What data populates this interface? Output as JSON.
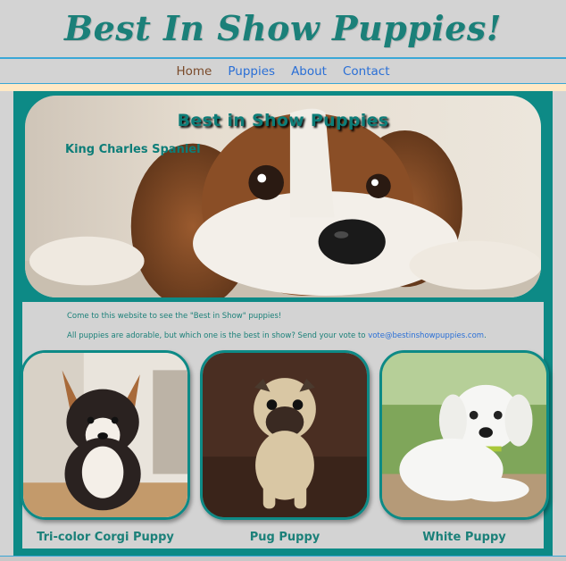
{
  "header": {
    "title": "Best In Show Puppies!"
  },
  "nav": {
    "items": [
      {
        "label": "Home",
        "active": true
      },
      {
        "label": "Puppies",
        "active": false
      },
      {
        "label": "About",
        "active": false
      },
      {
        "label": "Contact",
        "active": false
      }
    ]
  },
  "hero": {
    "title": "Best in Show Puppies",
    "caption": "King Charles Spaniel"
  },
  "intro": {
    "line1": "Come to this website to see the \"Best in Show\" puppies!",
    "line2_prefix": "All puppies are adorable, but which one is the best in show? Send your vote to ",
    "email": "vote@bestinshowpuppies.com",
    "line2_suffix": "."
  },
  "cards": [
    {
      "caption": "Tri-color Corgi Puppy"
    },
    {
      "caption": "Pug Puppy"
    },
    {
      "caption": "White Puppy"
    }
  ],
  "colors": {
    "accent": "#0d8a86",
    "title": "#1b8079",
    "link": "#2a6fd6",
    "background": "#d3d3d3"
  }
}
